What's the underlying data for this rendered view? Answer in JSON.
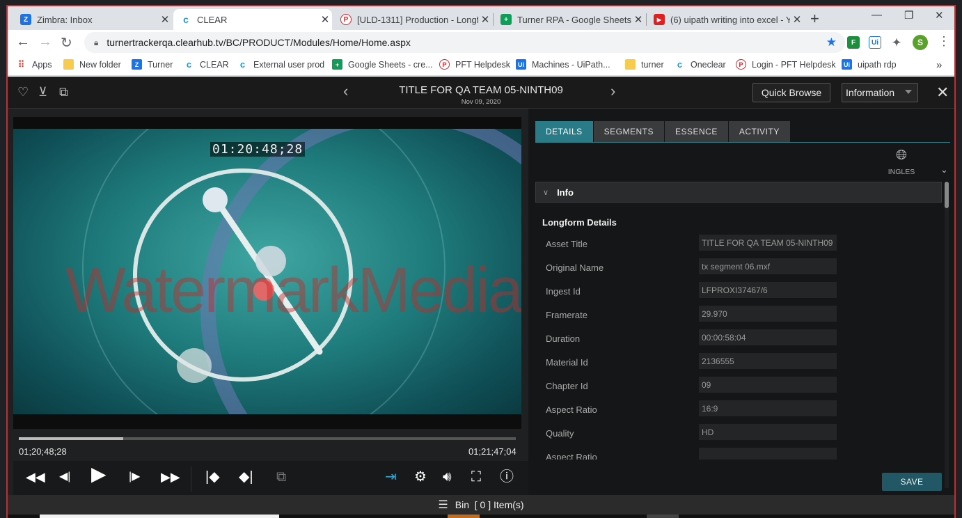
{
  "browser": {
    "tabs": [
      {
        "title": "Zimbra: Inbox",
        "icon": "zimbra-icon",
        "color": "#1a73e8",
        "glyph": "Z"
      },
      {
        "title": "CLEAR",
        "icon": "clear-icon",
        "color": "#1a9bd7",
        "glyph": "c"
      },
      {
        "title": "[ULD-1311] Production - Longf",
        "icon": "pft-icon",
        "color": "#e8e8e8",
        "glyph": "P"
      },
      {
        "title": "Turner RPA - Google Sheets",
        "icon": "sheets-icon",
        "color": "#0f9d58",
        "glyph": "+"
      },
      {
        "title": "(6) uipath writing into excel - Y",
        "icon": "youtube-icon",
        "color": "#e02020",
        "glyph": "▶"
      }
    ],
    "url": "turnertrackerqa.clearhub.tv/BC/PRODUCT/Modules/Home/Home.aspx",
    "profile_initial": "S",
    "bookmarks": [
      {
        "label": "Apps",
        "icon": "apps-grid-icon"
      },
      {
        "label": "New folder",
        "icon": "folder-icon"
      },
      {
        "label": "Turner",
        "icon": "zimbra-icon"
      },
      {
        "label": "CLEAR",
        "icon": "clear-icon"
      },
      {
        "label": "External user prod",
        "icon": "clear-icon"
      },
      {
        "label": "Google Sheets - cre...",
        "icon": "sheets-icon"
      },
      {
        "label": "PFT Helpdesk",
        "icon": "pft-icon"
      },
      {
        "label": "Machines - UiPath...",
        "icon": "uipath-icon"
      },
      {
        "label": "turner",
        "icon": "folder-icon"
      },
      {
        "label": "Oneclear",
        "icon": "clear-icon"
      },
      {
        "label": "Login - PFT Helpdesk",
        "icon": "pft-icon"
      },
      {
        "label": "uipath rdp",
        "icon": "uipath-icon"
      }
    ],
    "bookmarks_overflow": "»"
  },
  "header": {
    "title": "TITLE FOR QA TEAM 05-NINTH09",
    "date": "Nov 09, 2020",
    "quick_browse": "Quick Browse",
    "info_select": "Information"
  },
  "player": {
    "overlay_timecode": "01:20:48;28",
    "watermark": "WatermarkMedia",
    "current_tc": "01;20;48;28",
    "end_tc": "01;21;47;04",
    "progress": 0.21
  },
  "panel": {
    "tabs": [
      "DETAILS",
      "SEGMENTS",
      "ESSENCE",
      "ACTIVITY"
    ],
    "active_tab": "DETAILS",
    "language": "INGLES",
    "info_header": "Info",
    "section_title": "Longform Details",
    "fields": [
      {
        "label": "Asset Title",
        "value": "TITLE FOR QA TEAM 05-NINTH09"
      },
      {
        "label": "Original Name",
        "value": "tx segment 06.mxf"
      },
      {
        "label": "Ingest Id",
        "value": "LFPROXI37467/6"
      },
      {
        "label": "Framerate",
        "value": "29.970"
      },
      {
        "label": "Duration",
        "value": "00:00:58:04"
      },
      {
        "label": "Material Id",
        "value": "2136555"
      },
      {
        "label": "Chapter Id",
        "value": "09"
      },
      {
        "label": "Aspect Ratio",
        "value": "16:9"
      },
      {
        "label": "Quality",
        "value": "HD"
      },
      {
        "label": "Aspect Ratio",
        "value": ""
      }
    ],
    "save": "SAVE"
  },
  "bin": {
    "label": "Bin",
    "count_text": "[ 0 ] Item(s)"
  }
}
